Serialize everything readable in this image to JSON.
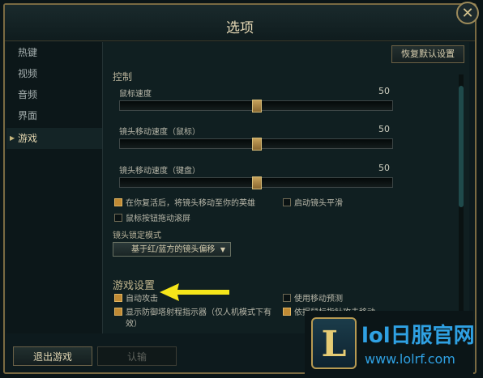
{
  "window": {
    "title": "选项",
    "close_icon": "close-icon"
  },
  "sidebar": {
    "items": [
      {
        "label": "热键",
        "active": false
      },
      {
        "label": "视频",
        "active": false
      },
      {
        "label": "音频",
        "active": false
      },
      {
        "label": "界面",
        "active": false
      },
      {
        "label": "游戏",
        "active": true
      }
    ]
  },
  "panel": {
    "reset_label": "恢复默认设置",
    "control_section": "控制",
    "sliders": [
      {
        "label": "鼠标速度",
        "value": "50",
        "fraction": 0.5
      },
      {
        "label": "镜头移动速度（鼠标）",
        "value": "50",
        "fraction": 0.5
      },
      {
        "label": "镜头移动速度（键盘）",
        "value": "50",
        "fraction": 0.5
      }
    ],
    "checks_control": [
      {
        "label": "在你复活后，将镜头移动至你的英雄",
        "checked": true
      },
      {
        "label": "启动镜头平滑",
        "checked": false
      },
      {
        "label": "鼠标按钮拖动滚屏",
        "checked": false
      }
    ],
    "camera_lock_label": "镜头锁定模式",
    "camera_lock_value": "基于红/蓝方的镜头偏移",
    "game_section": "游戏设置",
    "checks_game": [
      {
        "label": "自动攻击",
        "checked": true
      },
      {
        "label": "使用移动预测",
        "checked": false
      },
      {
        "label": "显示防御塔射程指示器（仅人机模式下有",
        "checked": true
      },
      {
        "label": "效）",
        "checked": true
      },
      {
        "label": "依据鼠标指针攻击移动",
        "checked": true
      }
    ]
  },
  "footer": {
    "exit_label": "退出游戏",
    "confirm_label": "认输"
  },
  "watermark": {
    "title": "lol日服官网",
    "url": "www.lolrf.com",
    "badge": "L"
  },
  "colors": {
    "accent": "#c8a15a",
    "arrow": "#f5e51a"
  }
}
